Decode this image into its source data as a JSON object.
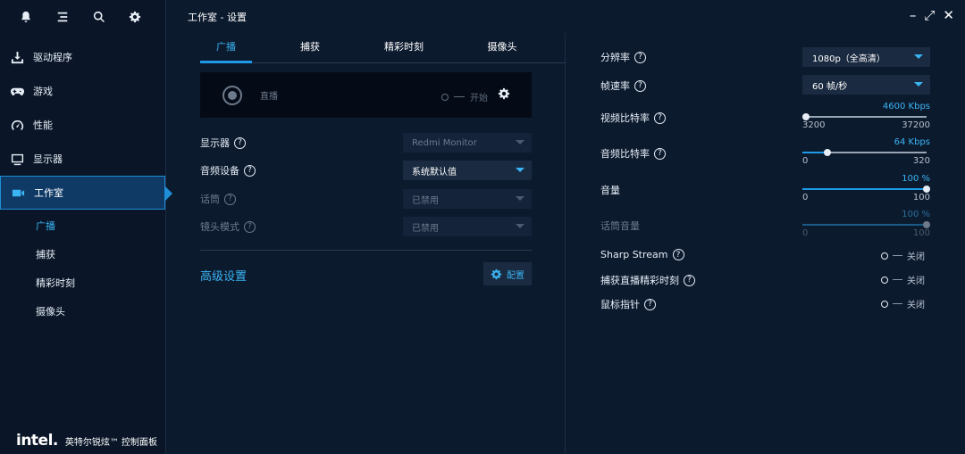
{
  "window": {
    "title": "工作室 - 设置"
  },
  "sidebar": {
    "top_icons": [
      "bell-icon",
      "menu-icon",
      "search-icon",
      "gear-icon"
    ],
    "items": [
      {
        "label": "驱动程序",
        "icon": "download-icon"
      },
      {
        "label": "游戏",
        "icon": "gamepad-icon"
      },
      {
        "label": "性能",
        "icon": "gauge-icon"
      },
      {
        "label": "显示器",
        "icon": "monitor-icon"
      },
      {
        "label": "工作室",
        "icon": "camera-icon",
        "active": true
      }
    ],
    "sub_items": [
      {
        "label": "广播",
        "active": true
      },
      {
        "label": "捕获"
      },
      {
        "label": "精彩时刻"
      },
      {
        "label": "摄像头"
      }
    ],
    "brand_logo": "intel.",
    "brand_text": "英特尔锐炫™ 控制面板"
  },
  "tabs": [
    "广播",
    "捕获",
    "精彩时刻",
    "摄像头"
  ],
  "stream": {
    "label": "直播",
    "toggle_label": "开始"
  },
  "settings": {
    "display": {
      "label": "显示器",
      "value": "Redmi Monitor"
    },
    "audio_device": {
      "label": "音频设备",
      "value": "系统默认值"
    },
    "microphone": {
      "label": "话筒",
      "value": "已禁用"
    },
    "camera_mode": {
      "label": "镜头模式",
      "value": "已禁用"
    }
  },
  "advanced": {
    "label": "高级设置",
    "config_button": "配置"
  },
  "right": {
    "resolution": {
      "label": "分辨率",
      "value": "1080p（全高清）"
    },
    "framerate": {
      "label": "帧速率",
      "value": "60 帧/秒"
    },
    "video_bitrate": {
      "label": "视频比特率",
      "value": "4600 Kbps",
      "min": "3200",
      "max": "37200",
      "level": 0.0
    },
    "audio_bitrate": {
      "label": "音频比特率",
      "value": "64 Kbps",
      "min": "0",
      "max": "320",
      "level": 0.2
    },
    "volume": {
      "label": "音量",
      "value": "100 %",
      "min": "0",
      "max": "100",
      "level": 1.0
    },
    "mic_volume": {
      "label": "话筒音量",
      "value": "100 %",
      "min": "0",
      "max": "100",
      "level": 1.0
    },
    "sharp_stream": {
      "label": "Sharp Stream",
      "state": "关闭"
    },
    "capture_highlights": {
      "label": "捕获直播精彩时刻",
      "state": "关闭"
    },
    "mouse_pointer": {
      "label": "鼠标指针",
      "state": "关闭"
    }
  },
  "colors": {
    "accent": "#1e9ae8",
    "background": "#0c1a2e",
    "sidebar": "#0a1628"
  }
}
